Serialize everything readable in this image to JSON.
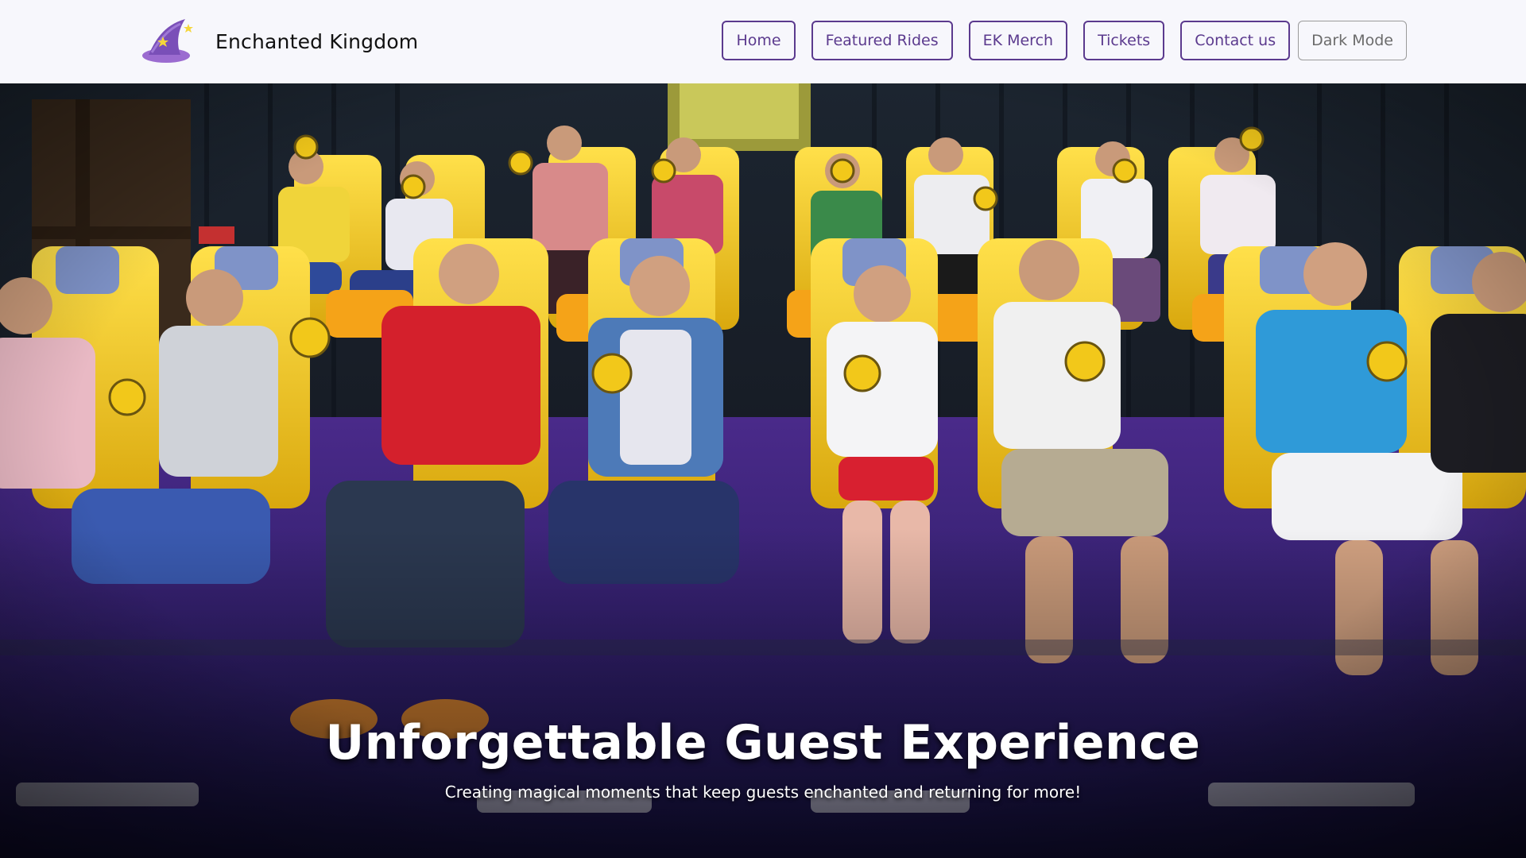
{
  "brand": {
    "name": "Enchanted Kingdom",
    "logo_icon": "wizard-hat-icon"
  },
  "nav": {
    "items": [
      {
        "label": "Home"
      },
      {
        "label": "Featured Rides"
      },
      {
        "label": "EK Merch"
      },
      {
        "label": "Tickets"
      },
      {
        "label": "Contact us"
      }
    ],
    "dark_mode_label": "Dark Mode"
  },
  "hero": {
    "title": "Unforgettable Guest Experience",
    "subtitle": "Creating magical moments that keep guests enchanted and returning for more!"
  },
  "colors": {
    "accent": "#5b3a8e",
    "nav_bg": "#f7f7fc",
    "seat_yellow": "#f2c81a"
  }
}
